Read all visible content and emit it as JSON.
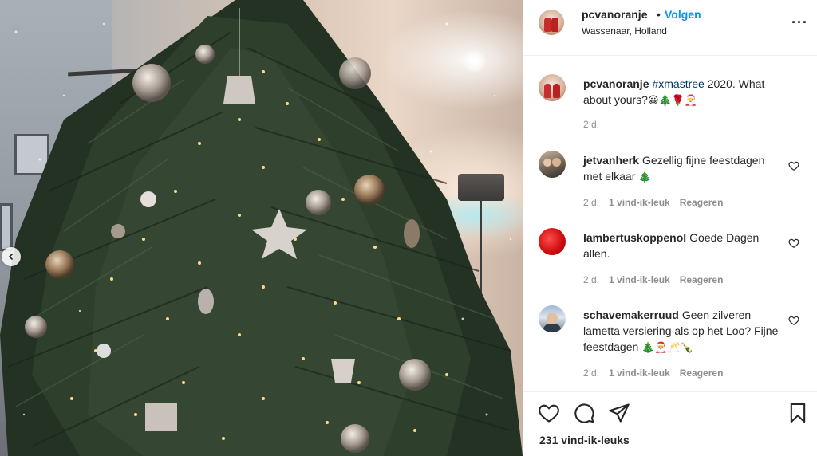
{
  "post": {
    "alt": "Christmas tree with ornaments and lights",
    "carousel_prev_icon": "chevron-left-icon"
  },
  "header": {
    "username": "pcvanoranje",
    "separator": "•",
    "follow_label": "Volgen",
    "location": "Wassenaar, Holland",
    "more_icon": "more-horizontal-icon",
    "more_label": "···"
  },
  "caption": {
    "username": "pcvanoranje",
    "hashtag": "#xmastree",
    "text": " 2020. What about yours?",
    "emojis": "😀🎄🌹🎅",
    "time": "2 d."
  },
  "comments": [
    {
      "username": "jetvanherk",
      "text": "Gezellig fijne feestdagen met elkaar",
      "emojis": "🎄",
      "time": "2 d.",
      "likes": "1 vind-ik-leuk",
      "reply": "Reageren"
    },
    {
      "username": "lambertuskoppenol",
      "text": "Goede Dagen allen.",
      "emojis": "",
      "time": "2 d.",
      "likes": "1 vind-ik-leuk",
      "reply": "Reageren"
    },
    {
      "username": "schavemakerruud",
      "text": "Geen zilveren lametta versiering als op het Loo? Fijne feestdagen",
      "emojis": "🎄🎅🥂🍾",
      "time": "2 d.",
      "likes": "1 vind-ik-leuk",
      "reply": "Reageren"
    }
  ],
  "actions": {
    "like_icon": "heart-icon",
    "comment_icon": "comment-icon",
    "share_icon": "share-icon",
    "save_icon": "bookmark-icon",
    "likes_count": "231 vind-ik-leuks"
  },
  "colors": {
    "accent": "#0095f6",
    "text": "#262626",
    "muted": "#8e8e8e",
    "hashtag": "#00376b",
    "border": "#efefef"
  }
}
